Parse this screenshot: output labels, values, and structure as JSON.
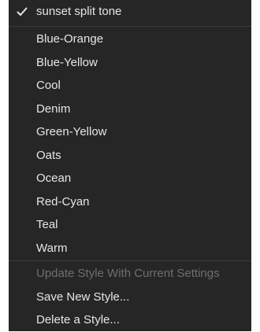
{
  "menu": {
    "selected_style": "sunset split tone",
    "styles": [
      "Blue-Orange",
      "Blue-Yellow",
      "Cool",
      "Denim",
      "Green-Yellow",
      "Oats",
      "Ocean",
      "Red-Cyan",
      "Teal",
      "Warm"
    ],
    "actions": {
      "update_style": "Update Style With Current Settings",
      "update_style_enabled": false,
      "save_new_style": "Save New Style...",
      "delete_style": "Delete a Style..."
    },
    "icons": {
      "checkmark": "checkmark-icon"
    },
    "colors": {
      "background": "#262626",
      "text": "#e6e6e6",
      "disabled_text": "#6f6f6f",
      "separator": "#3a3a3a"
    }
  }
}
